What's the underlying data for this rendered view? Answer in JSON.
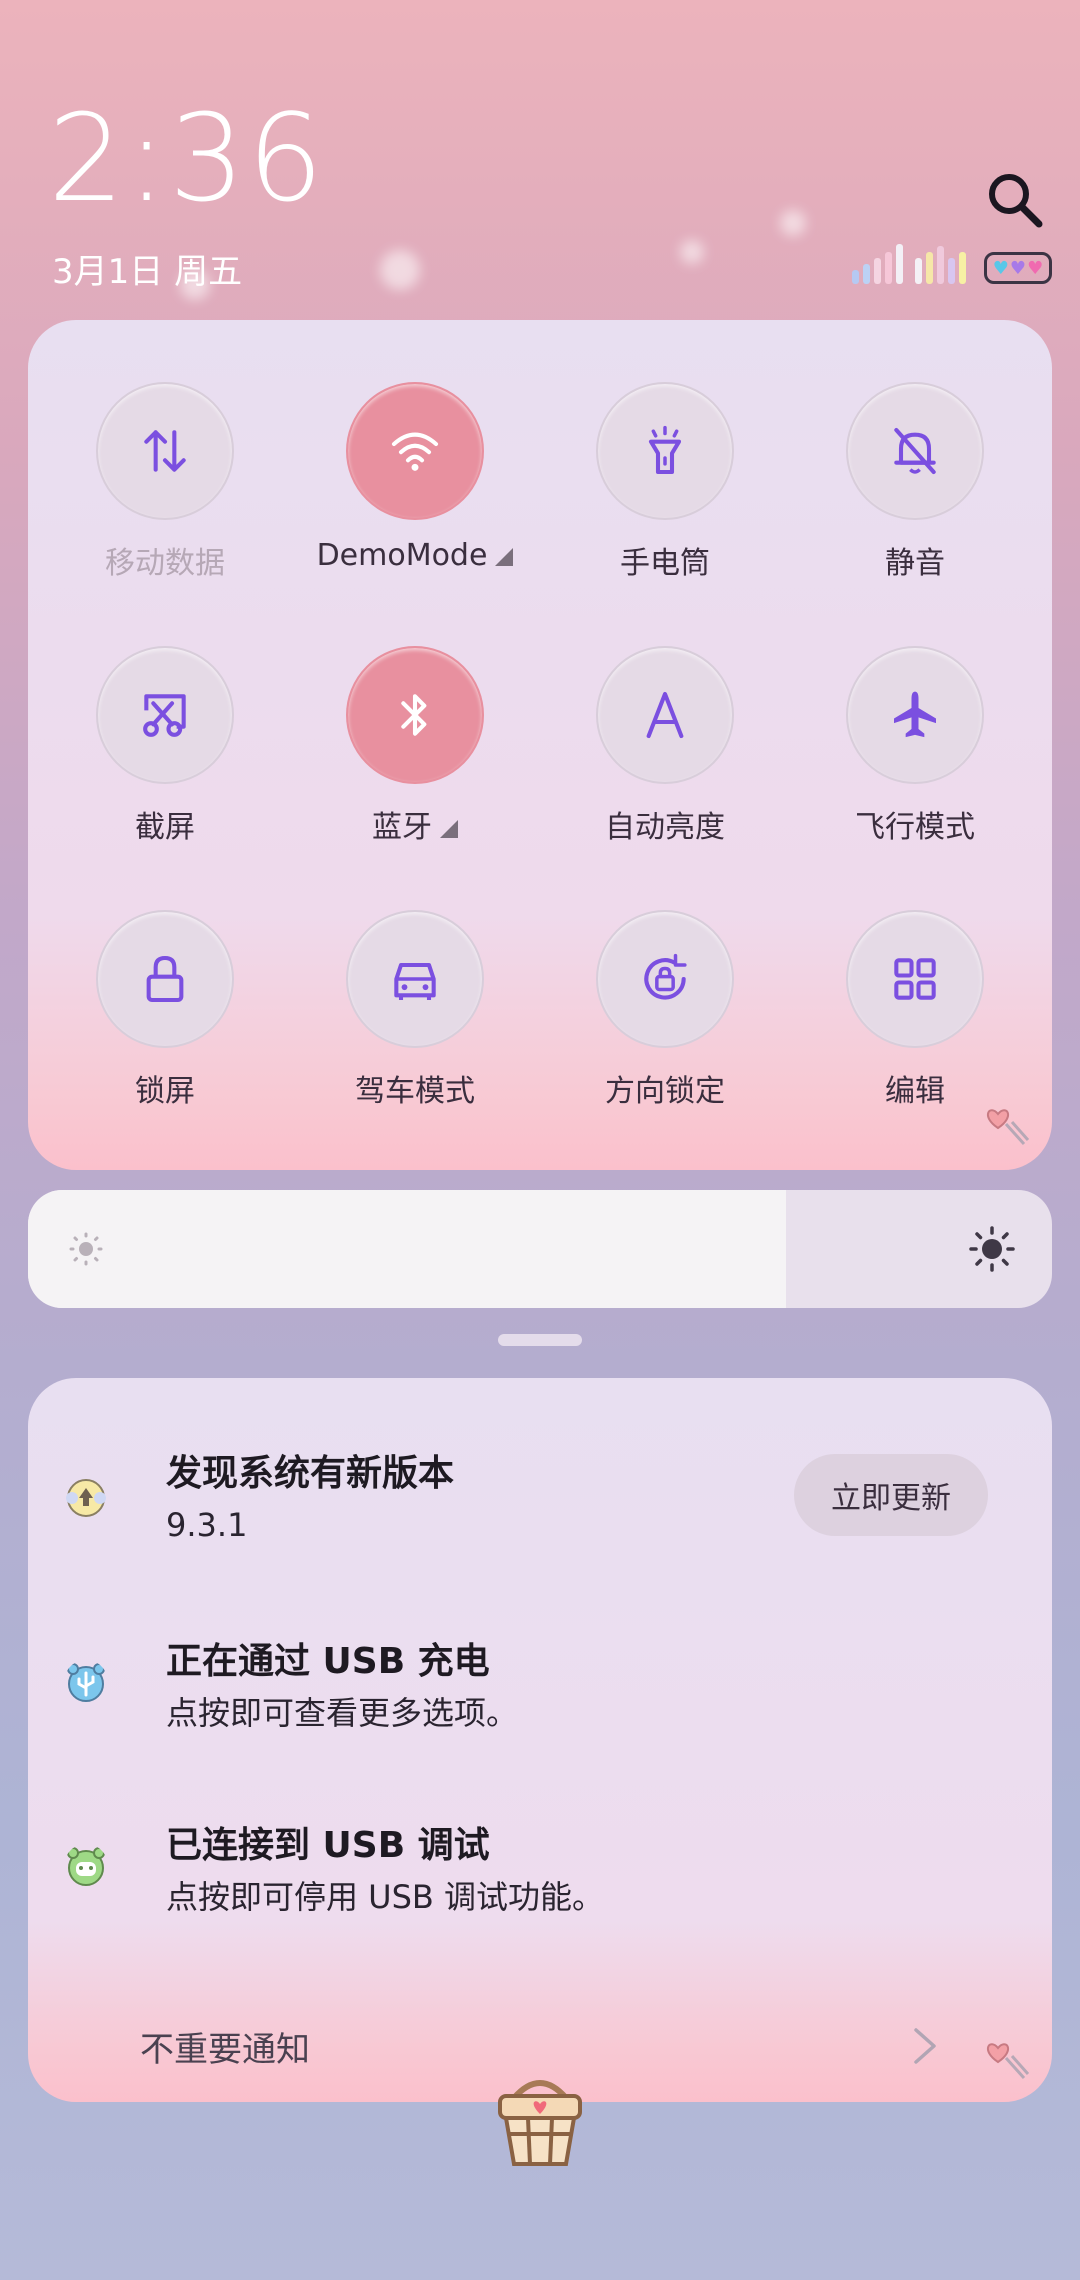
{
  "status_bar": {
    "time": "2:36",
    "date": "3月1日 周五"
  },
  "quick_settings": {
    "tiles": [
      {
        "label": "移动数据",
        "icon": "mobile-data-icon",
        "active": false,
        "dim": true
      },
      {
        "label": "DemoMode",
        "icon": "wifi-icon",
        "active": true,
        "dropdown": true
      },
      {
        "label": "手电筒",
        "icon": "flashlight-icon",
        "active": false
      },
      {
        "label": "静音",
        "icon": "mute-bell-icon",
        "active": false
      },
      {
        "label": "截屏",
        "icon": "screenshot-icon",
        "active": false
      },
      {
        "label": "蓝牙",
        "icon": "bluetooth-icon",
        "active": true,
        "dropdown": true
      },
      {
        "label": "自动亮度",
        "icon": "auto-brightness-icon",
        "active": false
      },
      {
        "label": "飞行模式",
        "icon": "airplane-icon",
        "active": false
      },
      {
        "label": "锁屏",
        "icon": "lock-icon",
        "active": false
      },
      {
        "label": "驾车模式",
        "icon": "car-icon",
        "active": false
      },
      {
        "label": "方向锁定",
        "icon": "rotation-lock-icon",
        "active": false
      },
      {
        "label": "编辑",
        "icon": "grid-edit-icon",
        "active": false
      }
    ]
  },
  "brightness": {
    "level": 0.74
  },
  "notifications": [
    {
      "title": "发现系统有新版本",
      "body": "9.3.1",
      "action": "立即更新",
      "icon": "system-update-icon"
    },
    {
      "title": "正在通过 USB 充电",
      "body": "点按即可查看更多选项。",
      "icon": "usb-icon"
    },
    {
      "title": "已连接到 USB 调试",
      "body": "点按即可停用 USB 调试功能。",
      "icon": "android-debug-icon"
    }
  ],
  "unimportant_label": "不重要通知",
  "colors": {
    "accent": "#7b4fe0",
    "active_tile": "#e8909f"
  }
}
